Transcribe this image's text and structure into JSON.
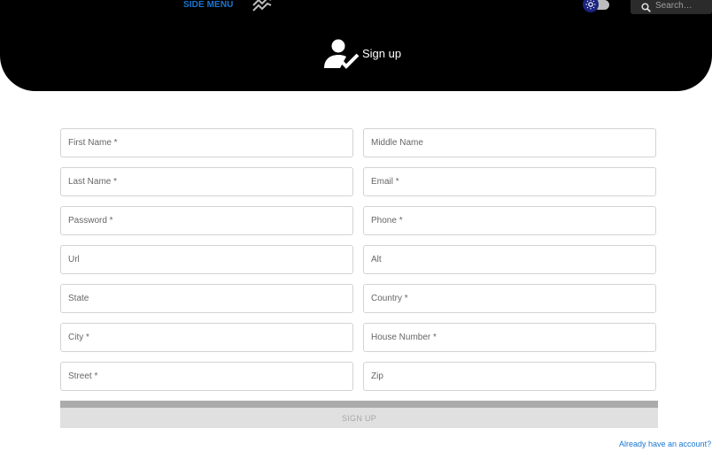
{
  "header": {
    "side_menu_label": "SIDE MENU",
    "search_placeholder": "Search…",
    "title": "Sign up"
  },
  "form": {
    "fields": [
      {
        "name": "first-name",
        "placeholder": "First Name *"
      },
      {
        "name": "middle-name",
        "placeholder": "Middle Name"
      },
      {
        "name": "last-name",
        "placeholder": "Last Name *"
      },
      {
        "name": "email",
        "placeholder": "Email *"
      },
      {
        "name": "password",
        "placeholder": "Password *"
      },
      {
        "name": "phone",
        "placeholder": "Phone *"
      },
      {
        "name": "url",
        "placeholder": "Url"
      },
      {
        "name": "alt",
        "placeholder": "Alt"
      },
      {
        "name": "state",
        "placeholder": "State"
      },
      {
        "name": "country",
        "placeholder": "Country *"
      },
      {
        "name": "city",
        "placeholder": "City *"
      },
      {
        "name": "house-number",
        "placeholder": "House Number *"
      },
      {
        "name": "street",
        "placeholder": "Street *"
      },
      {
        "name": "zip",
        "placeholder": "Zip"
      }
    ],
    "submit_label": "SIGN UP",
    "login_link": "Already have an account? S"
  },
  "colors": {
    "header_bg": "#000000",
    "accent": "#1976d2",
    "button_bg": "#e0e0e0"
  },
  "icons": [
    "waves-icon",
    "sun-icon",
    "search-icon",
    "user-check-icon"
  ]
}
